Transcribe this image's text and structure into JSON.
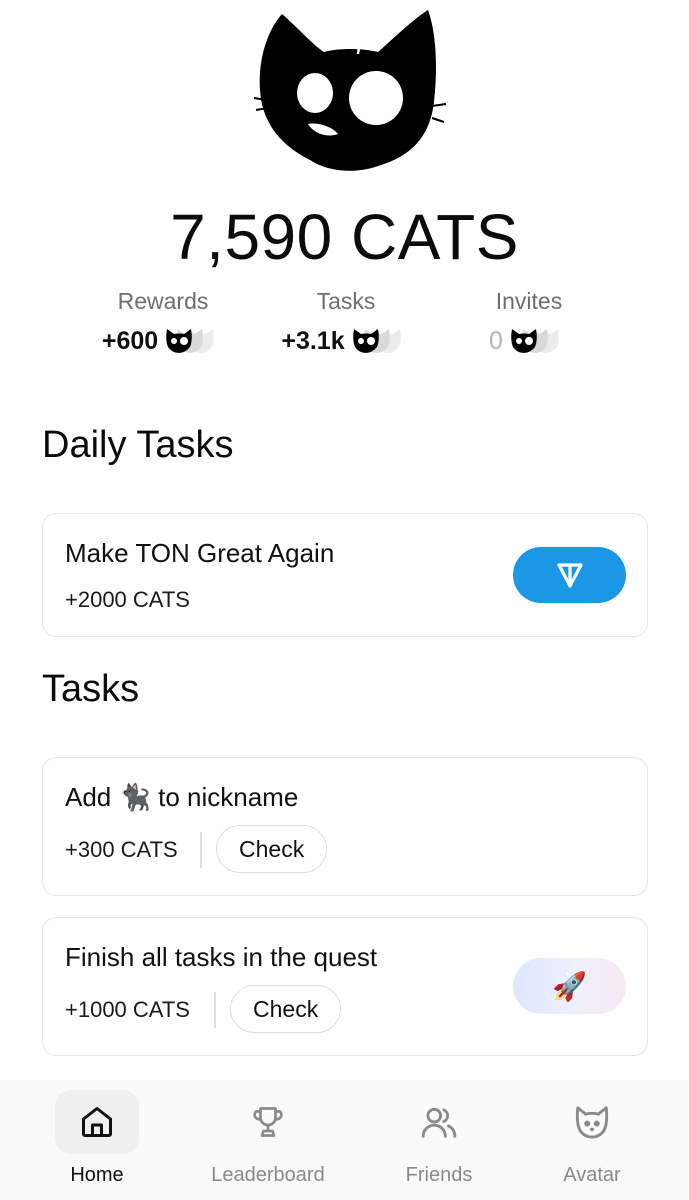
{
  "balance": "7,590 CATS",
  "stats": [
    {
      "label": "Rewards",
      "value": "+600"
    },
    {
      "label": "Tasks",
      "value": "+3.1k"
    },
    {
      "label": "Invites",
      "value": "0"
    }
  ],
  "daily_tasks": {
    "title": "Daily Tasks",
    "items": [
      {
        "title": "Make TON Great Again",
        "reward": "+2000 CATS",
        "icon": "ton-icon",
        "accent": "#1a98e6"
      }
    ]
  },
  "tasks": {
    "title": "Tasks",
    "items": [
      {
        "title_before": "Add",
        "emoji": "🐈‍⬛",
        "title_after": "to nickname",
        "reward": "+300 CATS",
        "action": "Check"
      },
      {
        "title": "Finish all tasks in the quest",
        "reward": "+1000 CATS",
        "action": "Check",
        "icon": "rocket-icon",
        "emoji": "🚀"
      }
    ]
  },
  "nav": {
    "active": "Home",
    "items": [
      {
        "label": "Home",
        "icon": "home-icon"
      },
      {
        "label": "Leaderboard",
        "icon": "trophy-icon"
      },
      {
        "label": "Friends",
        "icon": "friends-icon"
      },
      {
        "label": "Avatar",
        "icon": "cat-icon"
      }
    ]
  }
}
